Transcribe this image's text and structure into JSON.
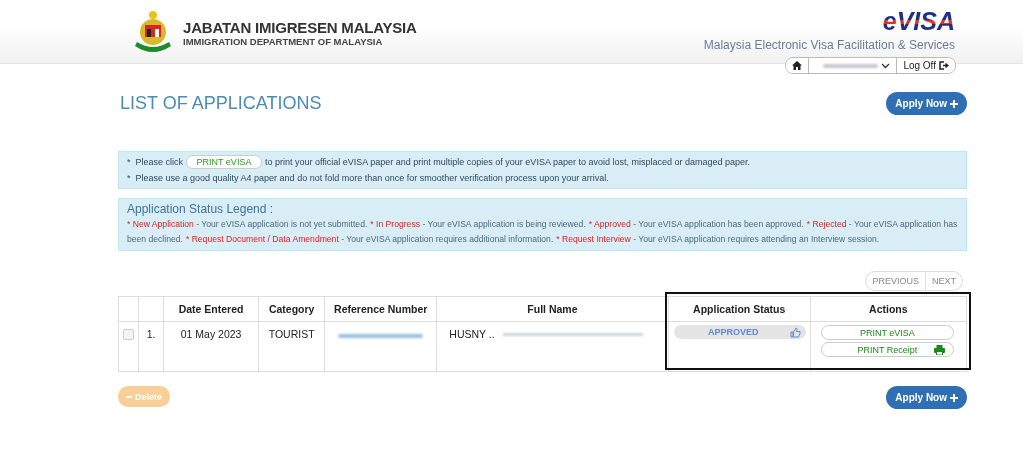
{
  "header": {
    "agency_title": "JABATAN IMIGRESEN MALAYSIA",
    "agency_subtitle": "IMMIGRATION DEPARTMENT OF MALAYSIA",
    "brand_logo": "eVISA",
    "brand_tagline": "Malaysia Electronic Visa Facilitation & Services",
    "nav": {
      "logout": "Log Off"
    }
  },
  "page_title": "LIST OF APPLICATIONS",
  "apply_button": "Apply Now",
  "notice": {
    "before": "*  Please click",
    "chip": "PRINT eVISA",
    "after": "to print your official eVISA paper and print multiple copies of your eVISA paper to avoid lost, misplaced or damaged paper.",
    "second": "*  Please use a good quality A4 paper and do not fold more than once for smoother verification process upon your arrival."
  },
  "legend": {
    "title": "Application Status Legend :",
    "items": [
      {
        "term": "* New Application",
        "description": "- Your eVISA application is not yet submitted."
      },
      {
        "term": "* In Progress",
        "description": "- Your eVISA application is being reviewed."
      },
      {
        "term": "* Approved",
        "description": "- Your eVISA application has been approved."
      },
      {
        "term": "* Rejected",
        "description": "- Your eVISA application has been declined."
      },
      {
        "term": "* Request Document / Data Amendment",
        "description": "- Your eVISA application requires additional information."
      },
      {
        "term": "* Request Interview",
        "description": "- Your eVISA application requires attending an Interview session."
      }
    ]
  },
  "pagination": {
    "previous": "PREVIOUS",
    "next": "NEXT"
  },
  "table": {
    "columns": [
      "Date Entered",
      "Category",
      "Reference Number",
      "Full Name",
      "Application Status",
      "Actions"
    ],
    "rows": [
      {
        "checked": false,
        "number": "1.",
        "date": "01 May 2023",
        "category": "TOURIST",
        "full_name": "HUSNY ..",
        "status": "APPROVED",
        "actions": [
          "PRINT eVISA",
          "PRINT Receipt"
        ]
      }
    ]
  },
  "delete_button": {
    "label": "Delete",
    "disabled": true
  },
  "bottom_apply_button": "Apply Now"
}
